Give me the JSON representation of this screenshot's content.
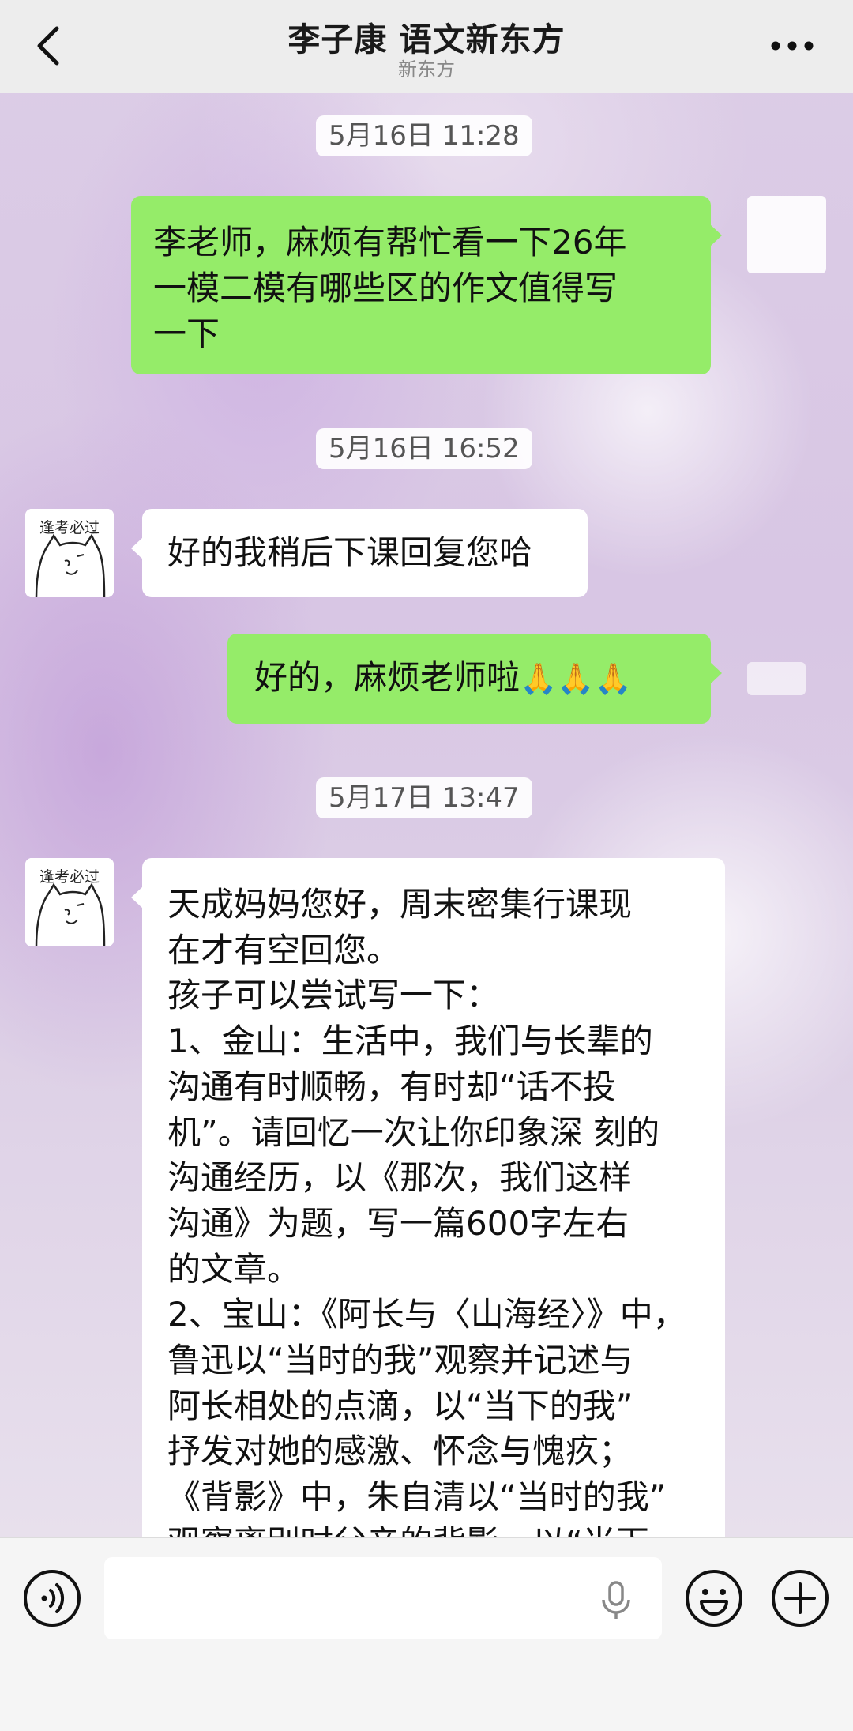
{
  "header": {
    "title": "李子康 语文新东方",
    "subtitle": "新东方"
  },
  "messages": [
    {
      "kind": "time",
      "text": "5月16日 11:28"
    },
    {
      "kind": "me",
      "lines": [
        "李老师，麻烦有帮忙看一下26年",
        "一模二模有哪些区的作文值得写",
        "一下"
      ]
    },
    {
      "kind": "time",
      "text": "5月16日 16:52"
    },
    {
      "kind": "them",
      "lines": [
        "好的我稍后下课回复您哈"
      ]
    },
    {
      "kind": "me",
      "text": "好的，麻烦老师啦",
      "emoji": "🙏🙏🙏"
    },
    {
      "kind": "time",
      "text": "5月17日 13:47"
    },
    {
      "kind": "them",
      "lines": [
        "天成妈妈您好，周末密集行课现",
        "在才有空回您。",
        "孩子可以尝试写一下：",
        "1、金山：生活中，我们与长辈的",
        "沟通有时顺畅，有时却“话不投",
        "机”。请回忆一次让你印象深 刻的",
        "沟通经历，以《那次，我们这样",
        "沟通》为题，写一篇600字左右",
        "的文章。",
        "2、宝山：《阿长与〈山海经〉》中，",
        "鲁迅以“当时的我”观察并记述与",
        "阿长相处的点滴，以“当下的我”",
        "抒发对她的感激、怀念与愧疚；",
        "《背影》中，朱自清以“当时的我”",
        "观察离别时父亲的背影，以“当下"
      ]
    }
  ],
  "avatar": {
    "text": "逢考必过"
  },
  "input": {
    "value": ""
  },
  "colors": {
    "my_bubble": "#95ec69",
    "their_bubble": "#ffffff",
    "header_bg": "#ededed"
  },
  "icons": [
    "back-arrow-icon",
    "more-icon",
    "voice-icon",
    "microphone-icon",
    "emoji-icon",
    "plus-icon"
  ]
}
